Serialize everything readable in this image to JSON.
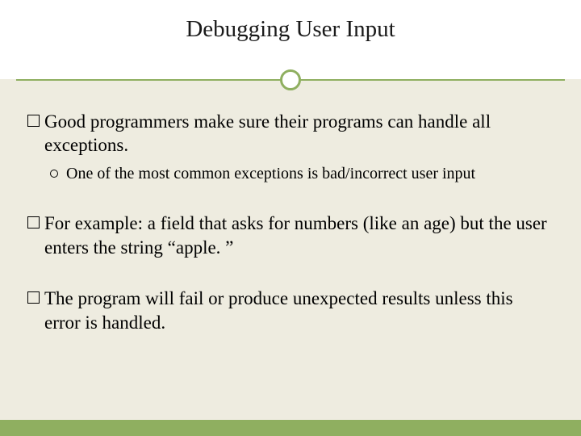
{
  "slide": {
    "title": "Debugging User Input",
    "bullets": [
      {
        "text": "Good programmers make sure their programs can handle all exceptions.",
        "sub": [
          {
            "text": "One of the most common exceptions is bad/incorrect user input"
          }
        ]
      },
      {
        "text": "For example: a field that asks for numbers (like an age) but the user enters the string “apple. ”",
        "sub": []
      },
      {
        "text": "The program will fail or produce unexpected results unless this error is handled.",
        "sub": []
      }
    ]
  },
  "theme": {
    "accent": "#8faf60",
    "background": "#eeece0",
    "header_background": "#ffffff"
  }
}
